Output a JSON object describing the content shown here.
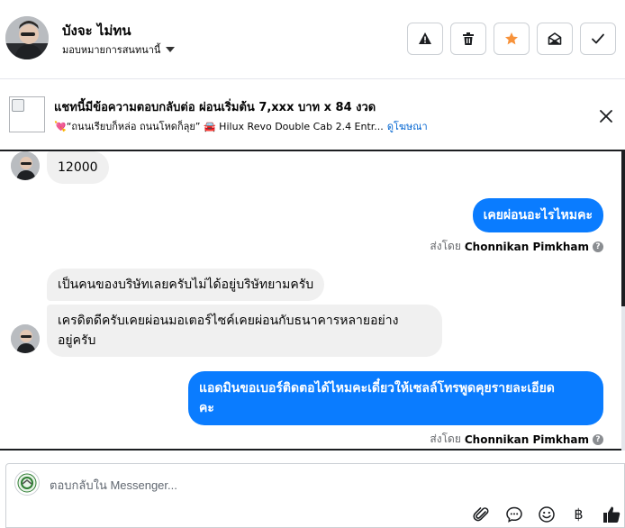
{
  "header": {
    "contact_name": "บังจะ ไม่ทน",
    "assign_label": "มอบหมายการสนทนานี้",
    "actions": [
      {
        "name": "report-spam-button",
        "icon": "warning-icon"
      },
      {
        "name": "delete-button",
        "icon": "trash-icon"
      },
      {
        "name": "star-button",
        "icon": "star-icon",
        "color": "#f7923a"
      },
      {
        "name": "mark-unread-button",
        "icon": "envelope-open-icon"
      },
      {
        "name": "mark-done-button",
        "icon": "check-icon"
      }
    ]
  },
  "ad": {
    "title": "แชทนี้มีข้อความตอบกลับต่อ ผ่อนเริ่มต้น 7,xxx บาท x 84 งวด",
    "subtitle": "💘“ถนนเรียบก็หล่อ ถนนโหดก็ลุย” 🚘 Hilux Revo Double Cab 2.4 Entr...",
    "link": "ดูโฆษณา"
  },
  "messages": [
    {
      "dir": "in",
      "text": "12000"
    },
    {
      "dir": "out",
      "text": "เคยผ่อนอะไรไหมคะ"
    },
    {
      "dir": "out-meta",
      "prefix": "ส่งโดย",
      "sender": "Chonnikan Pimkham"
    },
    {
      "dir": "in",
      "text": "เป็นคนของบริษัทเลยครับไม่ได้อยู่บริษัทยามครับ"
    },
    {
      "dir": "in",
      "lines": [
        "เครดิตดีครับเคยผ่อนมอเตอร์ไซค์เคยผ่อนกับธนาคารหลายอย่าง",
        "อยู่ครับ"
      ]
    },
    {
      "dir": "out",
      "lines": [
        "แอดมินขอเบอร์ติดตอได้ไหมคะเดี๋ยวให้เซลล์โทรพูดคุยรายละเอียด",
        "คะ"
      ]
    },
    {
      "dir": "out-meta",
      "prefix": "ส่งโดย",
      "sender": "Chonnikan Pimkham"
    }
  ],
  "composer": {
    "placeholder": "ตอบกลับใน Messenger...",
    "tools": [
      "paperclip-icon",
      "saved-reply-icon",
      "emoji-icon",
      "baht-icon",
      "thumbs-up-icon"
    ],
    "baht_glyph": "฿"
  },
  "colors": {
    "outgoing_bubble": "#0a7cff",
    "incoming_bubble": "#f0f0f0",
    "link": "#0064d1",
    "star": "#f7923a"
  }
}
